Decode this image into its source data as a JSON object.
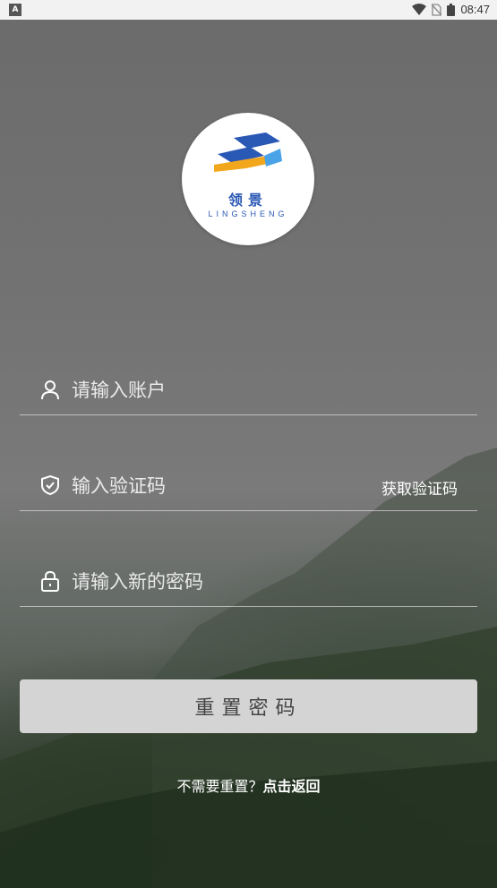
{
  "status_bar": {
    "time": "08:47",
    "left_icon": "A"
  },
  "logo": {
    "cn_text": "领景",
    "en_text": "LINGSHENG",
    "brand_blue": "#2a58b5",
    "brand_yellow": "#f2a61c"
  },
  "form": {
    "account_placeholder": "请输入账户",
    "code_placeholder": "输入验证码",
    "get_code_label": "获取验证码",
    "password_placeholder": "请输入新的密码"
  },
  "submit_label": "重置密码",
  "back": {
    "prompt": "不需要重置？",
    "link": "点击返回"
  },
  "icons": {
    "account": "user-icon",
    "code": "shield-check-icon",
    "password": "lock-icon"
  }
}
